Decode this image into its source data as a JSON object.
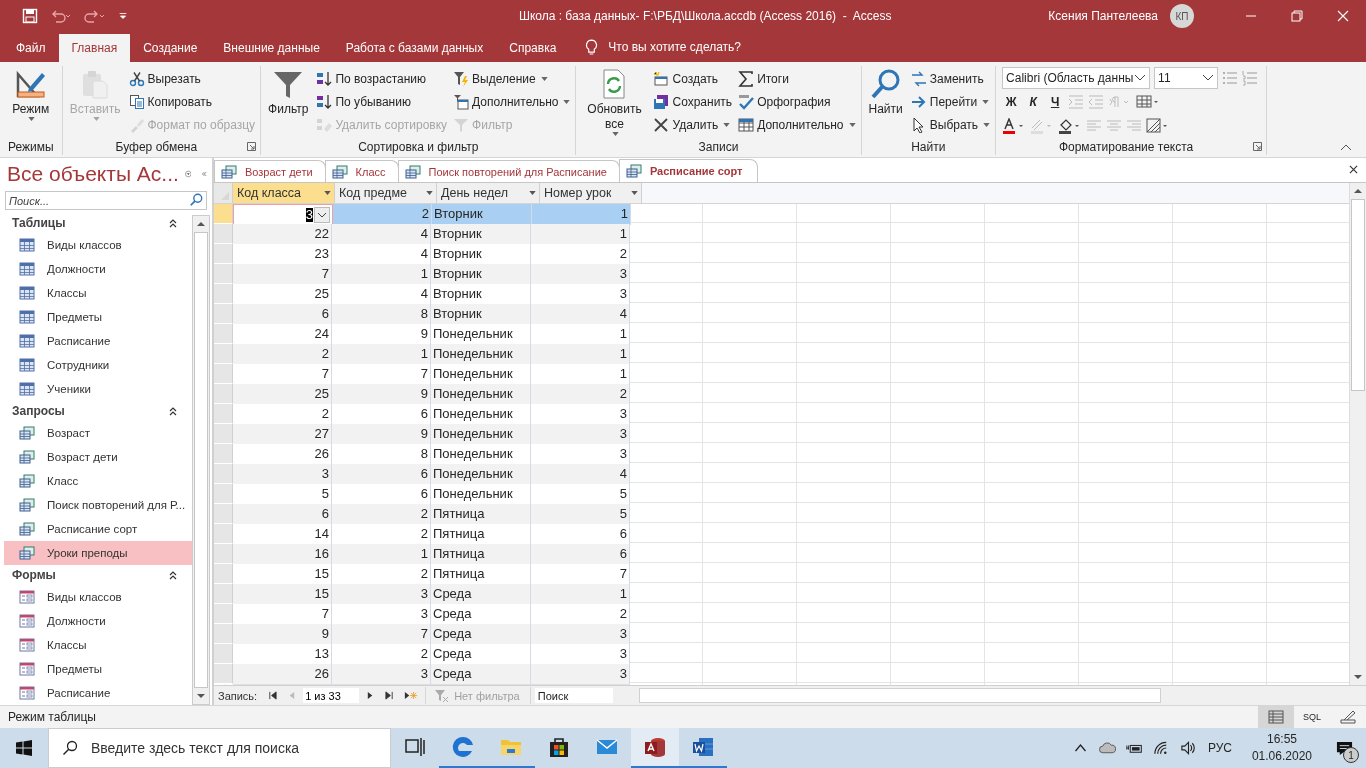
{
  "title_bar": {
    "title": "Школа : база данных- F:\\РБД\\Школа.accdb (Access 2016)  -  Access",
    "user": "Ксения Пантелеева",
    "avatar": "КП"
  },
  "menu_tabs": [
    {
      "label": "Файл",
      "selected": false
    },
    {
      "label": "Главная",
      "selected": true
    },
    {
      "label": "Создание",
      "selected": false
    },
    {
      "label": "Внешние данные",
      "selected": false
    },
    {
      "label": "Работа с базами данных",
      "selected": false
    },
    {
      "label": "Справка",
      "selected": false
    }
  ],
  "tell_me": {
    "placeholder": "Что вы хотите сделать?"
  },
  "ribbon": {
    "groups": [
      {
        "label": "Режимы",
        "items": [
          {
            "label": "Режим",
            "kind": "large",
            "disabled": false,
            "dropdown": true
          }
        ]
      },
      {
        "label": "Буфер обмена",
        "launcher": true,
        "items": [
          {
            "label": "Вставить",
            "kind": "large",
            "disabled": true,
            "dropdown": true
          },
          {
            "label": "Вырезать",
            "kind": "small",
            "disabled": false,
            "dropdown": false
          },
          {
            "label": "Копировать",
            "kind": "small",
            "disabled": false,
            "dropdown": false
          },
          {
            "label": "Формат по образцу",
            "kind": "small",
            "disabled": true,
            "dropdown": false
          }
        ]
      },
      {
        "label": "Сортировка и фильтр",
        "items": [
          {
            "label": "Фильтр",
            "kind": "large",
            "disabled": false,
            "dropdown": false
          },
          {
            "label": "По возрастанию",
            "kind": "small",
            "disabled": false,
            "dropdown": false
          },
          {
            "label": "По убыванию",
            "kind": "small",
            "disabled": false,
            "dropdown": false
          },
          {
            "label": "Удалить сортировку",
            "kind": "small",
            "disabled": true,
            "dropdown": false
          },
          {
            "label": "Выделение",
            "kind": "small",
            "disabled": false,
            "dropdown": true
          },
          {
            "label": "Дополнительно",
            "kind": "small",
            "disabled": false,
            "dropdown": true
          },
          {
            "label": "Фильтр",
            "kind": "small",
            "disabled": true,
            "dropdown": false
          }
        ]
      },
      {
        "label": "Записи",
        "items": [
          {
            "label": "Обновить все",
            "kind": "large",
            "disabled": false,
            "dropdown": true
          },
          {
            "label": "Создать",
            "kind": "small",
            "disabled": false,
            "dropdown": false
          },
          {
            "label": "Сохранить",
            "kind": "small",
            "disabled": false,
            "dropdown": false
          },
          {
            "label": "Удалить",
            "kind": "small",
            "disabled": false,
            "dropdown": true
          },
          {
            "label": "Итоги",
            "kind": "small",
            "disabled": false,
            "dropdown": false
          },
          {
            "label": "Орфография",
            "kind": "small",
            "disabled": false,
            "dropdown": false
          },
          {
            "label": "Дополнительно",
            "kind": "small",
            "disabled": false,
            "dropdown": true
          }
        ]
      },
      {
        "label": "Найти",
        "items": [
          {
            "label": "Найти",
            "kind": "large",
            "disabled": false,
            "dropdown": false
          },
          {
            "label": "Заменить",
            "kind": "small",
            "disabled": false,
            "dropdown": false
          },
          {
            "label": "Перейти",
            "kind": "small",
            "disabled": false,
            "dropdown": true
          },
          {
            "label": "Выбрать",
            "kind": "small",
            "disabled": false,
            "dropdown": true
          }
        ]
      }
    ],
    "format": {
      "label": "Форматирование текста",
      "launcher": true,
      "font": "Calibri (Область данны",
      "size": "11",
      "styles": [
        "Ж",
        "К",
        "Ч"
      ]
    }
  },
  "nav_pane": {
    "title": "Все объекты Ас...",
    "search": {
      "placeholder": "Поиск..."
    },
    "sections": [
      {
        "title": "Таблицы",
        "kind": "table",
        "expanded": true,
        "items": [
          {
            "label": "Виды классов",
            "selected": false
          },
          {
            "label": "Должности",
            "selected": false
          },
          {
            "label": "Классы",
            "selected": false
          },
          {
            "label": "Предметы",
            "selected": false
          },
          {
            "label": "Расписание",
            "selected": false
          },
          {
            "label": "Сотрудники",
            "selected": false
          },
          {
            "label": "Ученики",
            "selected": false
          }
        ]
      },
      {
        "title": "Запросы",
        "kind": "query",
        "expanded": true,
        "items": [
          {
            "label": "Возраст",
            "selected": false
          },
          {
            "label": "Возраст дети",
            "selected": false
          },
          {
            "label": "Класс",
            "selected": false
          },
          {
            "label": "Поиск повторений для Р...",
            "selected": false
          },
          {
            "label": "Расписание сорт",
            "selected": false
          },
          {
            "label": "Уроки преподы",
            "selected": true
          }
        ]
      },
      {
        "title": "Формы",
        "kind": "form",
        "expanded": true,
        "items": [
          {
            "label": "Виды классов",
            "selected": false
          },
          {
            "label": "Должности",
            "selected": false
          },
          {
            "label": "Классы",
            "selected": false
          },
          {
            "label": "Предметы",
            "selected": false
          },
          {
            "label": "Расписание",
            "selected": false
          }
        ]
      }
    ]
  },
  "doc_tabs": [
    {
      "label": "Возраст дети",
      "selected": false
    },
    {
      "label": "Класс",
      "selected": false
    },
    {
      "label": "Поиск повторений для Расписание",
      "selected": false
    },
    {
      "label": "Расписание сорт",
      "selected": true
    }
  ],
  "datasheet": {
    "columns": [
      {
        "label": "Код класса",
        "kind": "number",
        "selected": true
      },
      {
        "label": "Код предме",
        "kind": "number",
        "selected": false
      },
      {
        "label": "День недел",
        "kind": "text",
        "selected": false
      },
      {
        "label": "Номер урок",
        "kind": "number",
        "selected": false
      }
    ],
    "rows": [
      {
        "cells": [
          "3",
          "2",
          "Вторник",
          "1"
        ],
        "selected": true
      },
      {
        "cells": [
          "22",
          "4",
          "Вторник",
          "1"
        ],
        "selected": false
      },
      {
        "cells": [
          "23",
          "4",
          "Вторник",
          "2"
        ],
        "selected": false
      },
      {
        "cells": [
          "7",
          "1",
          "Вторник",
          "3"
        ],
        "selected": false
      },
      {
        "cells": [
          "25",
          "4",
          "Вторник",
          "3"
        ],
        "selected": false
      },
      {
        "cells": [
          "6",
          "8",
          "Вторник",
          "4"
        ],
        "selected": false
      },
      {
        "cells": [
          "24",
          "9",
          "Понедельник",
          "1"
        ],
        "selected": false
      },
      {
        "cells": [
          "2",
          "1",
          "Понедельник",
          "1"
        ],
        "selected": false
      },
      {
        "cells": [
          "7",
          "7",
          "Понедельник",
          "1"
        ],
        "selected": false
      },
      {
        "cells": [
          "25",
          "9",
          "Понедельник",
          "2"
        ],
        "selected": false
      },
      {
        "cells": [
          "2",
          "6",
          "Понедельник",
          "3"
        ],
        "selected": false
      },
      {
        "cells": [
          "27",
          "9",
          "Понедельник",
          "3"
        ],
        "selected": false
      },
      {
        "cells": [
          "26",
          "8",
          "Понедельник",
          "3"
        ],
        "selected": false
      },
      {
        "cells": [
          "3",
          "6",
          "Понедельник",
          "4"
        ],
        "selected": false
      },
      {
        "cells": [
          "5",
          "6",
          "Понедельник",
          "5"
        ],
        "selected": false
      },
      {
        "cells": [
          "6",
          "2",
          "Пятница",
          "5"
        ],
        "selected": false
      },
      {
        "cells": [
          "14",
          "2",
          "Пятница",
          "6"
        ],
        "selected": false
      },
      {
        "cells": [
          "16",
          "1",
          "Пятница",
          "6"
        ],
        "selected": false
      },
      {
        "cells": [
          "15",
          "2",
          "Пятница",
          "7"
        ],
        "selected": false
      },
      {
        "cells": [
          "15",
          "3",
          "Среда",
          "1"
        ],
        "selected": false
      },
      {
        "cells": [
          "7",
          "3",
          "Среда",
          "2"
        ],
        "selected": false
      },
      {
        "cells": [
          "9",
          "7",
          "Среда",
          "3"
        ],
        "selected": false
      },
      {
        "cells": [
          "13",
          "2",
          "Среда",
          "3"
        ],
        "selected": false
      },
      {
        "cells": [
          "26",
          "3",
          "Среда",
          "3"
        ],
        "selected": false
      }
    ]
  },
  "record_nav": {
    "label": "Запись:",
    "position": "1 из 33",
    "filter": "Нет фильтра",
    "search": {
      "placeholder": "Поиск"
    }
  },
  "status_bar": {
    "text": "Режим таблицы",
    "views": [
      {
        "kind": "datasheet",
        "selected": true
      },
      {
        "kind": "sql",
        "label": "SQL",
        "selected": false
      },
      {
        "kind": "design",
        "selected": false
      }
    ]
  },
  "taskbar": {
    "search": {
      "placeholder": "Введите здесь текст для поиска"
    },
    "apps": [
      {
        "kind": "taskview",
        "running": false,
        "active": false
      },
      {
        "kind": "edge",
        "running": true,
        "active": false
      },
      {
        "kind": "explorer",
        "running": true,
        "active": false
      },
      {
        "kind": "store",
        "running": false,
        "active": false
      },
      {
        "kind": "mail",
        "running": false,
        "active": false
      },
      {
        "kind": "access",
        "running": true,
        "active": true
      },
      {
        "kind": "word",
        "running": true,
        "active": false
      }
    ],
    "language": "РУС",
    "time": "16:55",
    "date": "01.06.2020",
    "notifications": "1"
  }
}
